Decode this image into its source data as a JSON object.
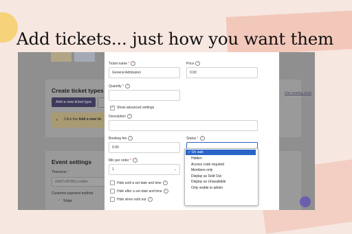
{
  "headline": "Add tickets... just how you want them",
  "background": {
    "create_ticket_types": "Create ticket types",
    "add_new_ticket_type_button": "Add a new ticket type",
    "use_seating_chart_link": "Use seating chart",
    "banner_text_prefix": "Click the",
    "banner_text_bold": "Add a new tic",
    "event_settings": "Event settings",
    "timezone_label": "Timezone",
    "timezone_value": "(GMT+00:00) London",
    "customer_payment_method": "Customer payment method",
    "stripe_label": "Stripe"
  },
  "form": {
    "ticket_name_label": "Ticket name",
    "ticket_name_value": "General Admission",
    "price_label": "Price",
    "price_value": "0.00",
    "quantity_label": "Quantity",
    "quantity_value": "",
    "advanced_settings_label": "Show advanced settings",
    "advanced_settings_checked": true,
    "description_label": "Description",
    "description_value": "",
    "booking_fee_label": "Booking fee",
    "booking_fee_value": "0.00",
    "status_label": "Status",
    "min_per_order_label": "Min per order",
    "min_per_order_value": "1",
    "hide_until_label": "Hide until a set date and time",
    "hide_after_label": "Hide after a set date and time",
    "hide_sold_out_label": "Hide when sold out",
    "required_marker": "*",
    "help_glyph": "?"
  },
  "status_dropdown": {
    "selected": "On sale",
    "check_glyph": "✓",
    "options": [
      "On sale",
      "Hidden",
      "Access code required",
      "Members only",
      "Display as Sold Out",
      "Display as Unavailable",
      "Only visible to admin"
    ]
  },
  "colors": {
    "selected_option": "#2a64c8",
    "required": "#d0342c",
    "primary_button": "#3d3a5a",
    "page_background": "#f7e7e1"
  }
}
